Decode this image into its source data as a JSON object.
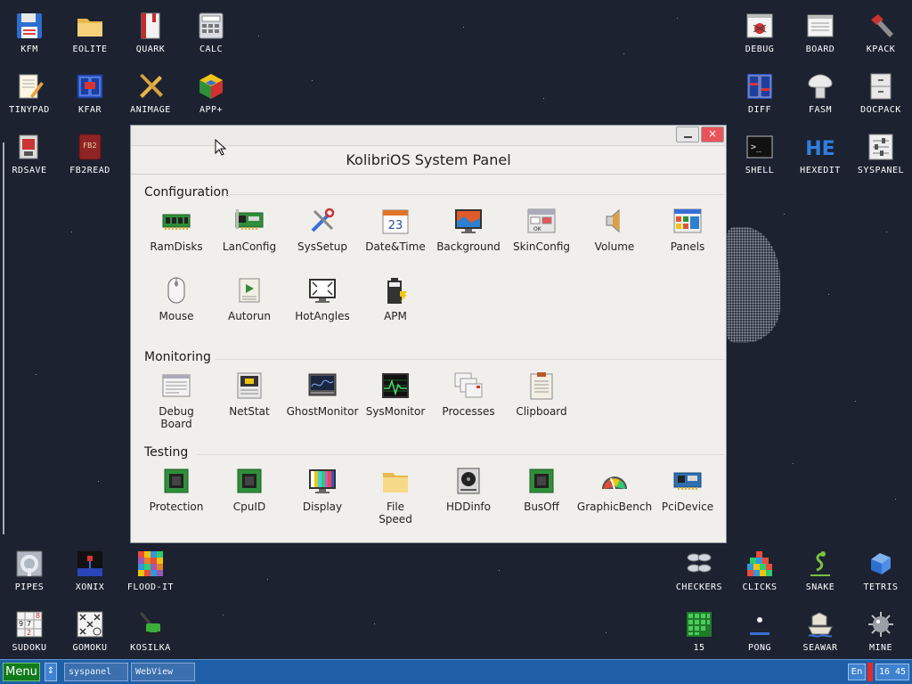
{
  "desktop": {
    "icons_left_top": [
      {
        "label": "KFM",
        "icon": "floppy-icon"
      },
      {
        "label": "EOLITE",
        "icon": "folder-icon"
      },
      {
        "label": "QUARK",
        "icon": "book-icon"
      },
      {
        "label": "CALC",
        "icon": "calculator-icon"
      },
      {
        "label": "TINYPAD",
        "icon": "notepad-icon"
      },
      {
        "label": "KFAR",
        "icon": "kfar-icon"
      },
      {
        "label": "ANIMAGE",
        "icon": "pencil-ruler-icon"
      },
      {
        "label": "APP+",
        "icon": "cube-icon"
      },
      {
        "label": "RDSAVE",
        "icon": "rdsave-icon"
      },
      {
        "label": "FB2READ",
        "icon": "fb2-book-icon"
      }
    ],
    "fb2_badge": "FB2",
    "icons_right_top": [
      {
        "label": "DEBUG",
        "icon": "bug-icon"
      },
      {
        "label": "BOARD",
        "icon": "board-icon"
      },
      {
        "label": "KPACK",
        "icon": "hammer-icon"
      },
      {
        "label": "DIFF",
        "icon": "diff-icon"
      },
      {
        "label": "FASM",
        "icon": "fasm-icon"
      },
      {
        "label": "DOCPACK",
        "icon": "cabinet-icon"
      },
      {
        "label": "SHELL",
        "icon": "terminal-icon"
      },
      {
        "label": "HEXEDIT",
        "icon": "hex-icon"
      },
      {
        "label": "SYSPANEL",
        "icon": "sliders-icon"
      }
    ],
    "shell_prompt": ">_",
    "hex_text": "HE",
    "icons_left_bottom": [
      {
        "label": "PIPES",
        "icon": "pipes-icon"
      },
      {
        "label": "XONIX",
        "icon": "xonix-icon"
      },
      {
        "label": "FLOOD-IT",
        "icon": "flood-icon"
      },
      {
        "label": "SUDOKU",
        "icon": "sudoku-icon"
      },
      {
        "label": "GOMOKU",
        "icon": "gomoku-icon"
      },
      {
        "label": "KOSILKA",
        "icon": "mower-icon"
      }
    ],
    "sudoku_digits": [
      "9",
      "7",
      "2",
      "8"
    ],
    "icons_right_bottom": [
      {
        "label": "CHECKERS",
        "icon": "checkers-icon"
      },
      {
        "label": "CLICKS",
        "icon": "clicks-icon"
      },
      {
        "label": "SNAKE",
        "icon": "snake-icon"
      },
      {
        "label": "TETRIS",
        "icon": "tetris-icon"
      },
      {
        "label": "15",
        "icon": "fifteen-icon"
      },
      {
        "label": "PONG",
        "icon": "pong-icon"
      },
      {
        "label": "SEAWAR",
        "icon": "seawar-icon"
      },
      {
        "label": "MINE",
        "icon": "mine-icon"
      }
    ]
  },
  "window": {
    "title": "KolibriOS System Panel",
    "close_glyph": "×",
    "calendar_day": "23",
    "skin_ok": "OK",
    "sections": [
      {
        "title": "Configuration",
        "items": [
          {
            "label": "RamDisks",
            "icon": "ram-icon"
          },
          {
            "label": "LanConfig",
            "icon": "network-card-icon"
          },
          {
            "label": "SysSetup",
            "icon": "tools-icon"
          },
          {
            "label": "Date&Time",
            "icon": "calendar-icon"
          },
          {
            "label": "Background",
            "icon": "monitor-icon"
          },
          {
            "label": "SkinConfig",
            "icon": "skin-icon"
          },
          {
            "label": "Volume",
            "icon": "speaker-icon"
          },
          {
            "label": "Panels",
            "icon": "panels-icon"
          },
          {
            "label": "Mouse",
            "icon": "mouse-icon"
          },
          {
            "label": "Autorun",
            "icon": "autorun-icon"
          },
          {
            "label": "HotAngles",
            "icon": "hotangles-icon"
          },
          {
            "label": "APM",
            "icon": "battery-icon"
          }
        ]
      },
      {
        "title": "Monitoring",
        "items": [
          {
            "label": "Debug\nBoard",
            "icon": "debug-board-icon"
          },
          {
            "label": "NetStat",
            "icon": "netstat-icon"
          },
          {
            "label": "GhostMonitor",
            "icon": "ghost-monitor-icon"
          },
          {
            "label": "SysMonitor",
            "icon": "sysmonitor-icon"
          },
          {
            "label": "Processes",
            "icon": "processes-icon"
          },
          {
            "label": "Clipboard",
            "icon": "clipboard-icon"
          }
        ]
      },
      {
        "title": "Testing",
        "items": [
          {
            "label": "Protection",
            "icon": "chip-icon"
          },
          {
            "label": "CpuID",
            "icon": "chip-icon"
          },
          {
            "label": "Display",
            "icon": "display-bars-icon"
          },
          {
            "label": "File\nSpeed",
            "icon": "folder-icon"
          },
          {
            "label": "HDDinfo",
            "icon": "hdd-icon"
          },
          {
            "label": "BusOff",
            "icon": "chip-icon"
          },
          {
            "label": "GraphicBench",
            "icon": "gauge-icon"
          },
          {
            "label": "PciDevice",
            "icon": "pci-card-icon"
          }
        ]
      }
    ]
  },
  "taskbar": {
    "menu_label": "Menu",
    "switch_glyph": "↕",
    "tasks": [
      "syspanel",
      "WebView"
    ],
    "lang": "En",
    "clock": "16 45"
  },
  "colors": {
    "desktop_bg": "#1c2230",
    "taskbar": "#1f5fa8",
    "menu_green": "#117a1c",
    "close_red": "#e8545a"
  }
}
